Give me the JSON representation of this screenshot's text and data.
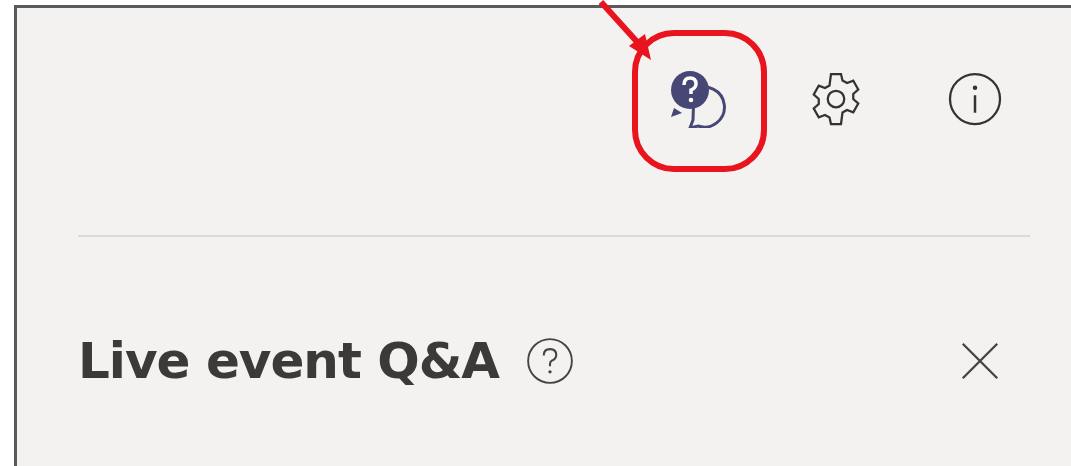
{
  "panel": {
    "title": "Live event Q&A"
  }
}
